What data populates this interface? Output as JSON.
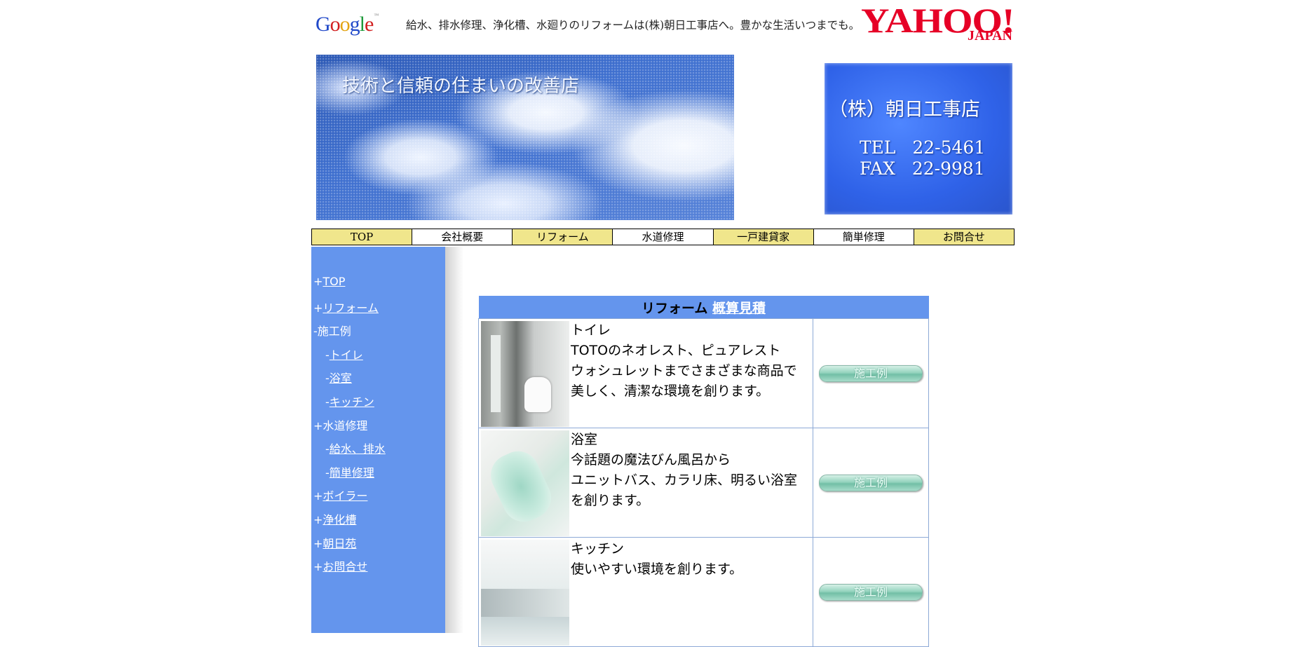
{
  "header": {
    "google_logo": "Google",
    "tagline": "給水、排水修理、浄化槽、水廻りのリフォームは(株)朝日工事店へ。豊かな生活いつまでも。",
    "yahoo_main": "YAHOO!",
    "yahoo_sub": "JAPAN"
  },
  "banner": {
    "slogan": "技術と信頼の住まいの改善店",
    "company": "（株）朝日工事店",
    "tel": "TEL   22-5461",
    "fax": "FAX   22-9981"
  },
  "topnav": [
    {
      "label": "TOP"
    },
    {
      "label": "会社概要"
    },
    {
      "label": "リフォーム"
    },
    {
      "label": "水道修理"
    },
    {
      "label": "一戸建貸家"
    },
    {
      "label": "簡単修理"
    },
    {
      "label": "お問合せ"
    }
  ],
  "sidebar": {
    "items": [
      {
        "prefix": "+",
        "label": "TOP"
      },
      {
        "prefix": "+",
        "label": "リフォーム"
      },
      {
        "prefix": "-",
        "label": "施工例"
      },
      {
        "prefix": "-",
        "label": "トイレ"
      },
      {
        "prefix": "-",
        "label": "浴室"
      },
      {
        "prefix": "-",
        "label": "キッチン"
      },
      {
        "prefix": "+",
        "label": "水道修理"
      },
      {
        "prefix": "-",
        "label": "給水、排水"
      },
      {
        "prefix": "-",
        "label": "簡単修理"
      },
      {
        "prefix": "+",
        "label": "ボイラー"
      },
      {
        "prefix": "+",
        "label": "浄化槽"
      },
      {
        "prefix": "+",
        "label": "朝日苑"
      },
      {
        "prefix": "+",
        "label": "お問合せ"
      }
    ]
  },
  "reform": {
    "title": "リフォーム",
    "estimate_link": "概算見積",
    "rows": [
      {
        "line1": "トイレ",
        "line2": "TOTOのネオレスト、ピュアレスト",
        "line3": "ウォシュレットまでさまざまな商品で",
        "line4": "美しく、清潔な環境を創ります。",
        "button": "施工例"
      },
      {
        "line1": "浴室",
        "line2": "今話題の魔法びん風呂から",
        "line3": "ユニットバス、カラリ床、明るい浴室",
        "line4": "を創ります。",
        "button": "施工例"
      },
      {
        "line1": "キッチン",
        "line2": "使いやすい環境を創ります。",
        "button": "施工例"
      }
    ]
  }
}
